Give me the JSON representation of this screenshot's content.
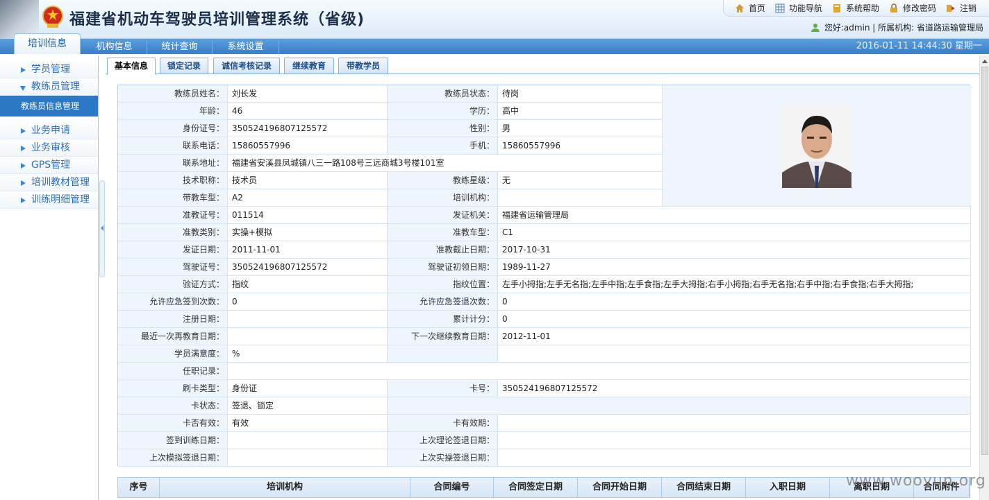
{
  "header": {
    "title": "福建省机动车驾驶员培训管理系统（省级)",
    "links": [
      "首页",
      "功能导航",
      "系统帮助",
      "修改密码",
      "注销"
    ],
    "user_info": "您好:admin | 所属机构: 省道路运输管理局"
  },
  "nav": {
    "tabs": [
      "培训信息",
      "机构信息",
      "统计查询",
      "系统设置"
    ],
    "datetime": "2016-01-11 14:44:30 星期一"
  },
  "sidebar": {
    "items": [
      "学员管理",
      "教练员管理",
      "业务申请",
      "业务审核",
      "GPS管理",
      "培训教材管理",
      "训练明细管理"
    ],
    "sub_item": "教练员信息管理"
  },
  "tabs": [
    "基本信息",
    "锁定记录",
    "诚信考核记录",
    "继续教育",
    "带教学员"
  ],
  "info": {
    "r0": [
      "教练员姓名：",
      "刘长发",
      "教练员状态：",
      "待岗"
    ],
    "r1": [
      "年龄：",
      "46",
      "学历：",
      "高中"
    ],
    "r2": [
      "身份证号：",
      "350524196807125572",
      "性别：",
      "男"
    ],
    "r3": [
      "联系电话：",
      "15860557996",
      "手机：",
      "15860557996"
    ],
    "r4": [
      "联系地址：",
      "福建省安溪县凤城镇八三一路108号三远商城3号楼101室"
    ],
    "r5": [
      "技术职称：",
      "技术员",
      "教练星级：",
      "无"
    ],
    "r6": [
      "带教车型：",
      "A2",
      "培训机构：",
      ""
    ],
    "r7": [
      "准教证号：",
      "011514",
      "发证机关：",
      "福建省运输管理局"
    ],
    "r8": [
      "准教类别：",
      "实操+模拟",
      "准教车型：",
      "C1"
    ],
    "r9": [
      "发证日期：",
      "2011-11-01",
      "准教截止日期：",
      "2017-10-31"
    ],
    "r10": [
      "驾驶证号：",
      "350524196807125572",
      "驾驶证初领日期：",
      "1989-11-27"
    ],
    "r11": [
      "验证方式：",
      "指纹",
      "指纹位置：",
      "左手小拇指;左手无名指;左手中指;左手食指;左手大拇指;右手小拇指;右手无名指;右手中指;右手食指;右手大拇指;"
    ],
    "r12": [
      "允许应急签到次数：",
      "0",
      "允许应急签退次数：",
      "0"
    ],
    "r13": [
      "注册日期：",
      "",
      "累计计分：",
      "0"
    ],
    "r14": [
      "最近一次再教育日期：",
      "",
      "下一次继续教育日期：",
      "2012-11-01"
    ],
    "r15": [
      "学员满意度：",
      "%"
    ],
    "r16": [
      "任职记录：",
      ""
    ],
    "r17": [
      "刷卡类型：",
      "身份证",
      "卡号：",
      "350524196807125572"
    ],
    "r18": [
      "卡状态：",
      "签退、锁定"
    ],
    "r19": [
      "卡否有效：",
      "有效",
      "卡有效期：",
      ""
    ],
    "r20": [
      "签到训练日期：",
      "",
      "上次理论签退日期：",
      ""
    ],
    "r21": [
      "上次模拟签退日期：",
      "",
      "上次实操签退日期：",
      ""
    ]
  },
  "contract_table": {
    "headers": [
      "序号",
      "培训机构",
      "合同编号",
      "合同签定日期",
      "合同开始日期",
      "合同结束日期",
      "入职日期",
      "离职日期",
      "合同附件"
    ]
  },
  "watermark": "www.wooyun.org"
}
